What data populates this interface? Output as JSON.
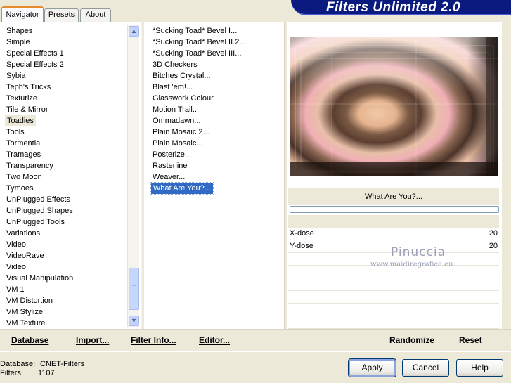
{
  "tabs": [
    {
      "label": "Navigator",
      "active": true
    },
    {
      "label": "Presets",
      "active": false
    },
    {
      "label": "About",
      "active": false
    }
  ],
  "banner_title": "Filters Unlimited 2.0",
  "categories": [
    "Shapes",
    "Simple",
    "Special Effects 1",
    "Special Effects 2",
    "Sybia",
    "Teph's Tricks",
    "Texturize",
    "Tile & Mirror",
    "Toadies",
    "Tools",
    "Tormentia",
    "Tramages",
    "Transparency",
    "Two Moon",
    "Tymoes",
    "UnPlugged Effects",
    "UnPlugged Shapes",
    "UnPlugged Tools",
    "Variations",
    "Video",
    "VideoRave",
    "Video",
    "Visual Manipulation",
    "VM 1",
    "VM Distortion",
    "VM Stylize",
    "VM Texture"
  ],
  "selected_category": "Toadies",
  "filters": [
    "*Sucking Toad*  Bevel I...",
    "*Sucking Toad*  Bevel II.2...",
    "*Sucking Toad*  Bevel III...",
    "3D Checkers",
    "Bitches Crystal...",
    "Blast 'em!...",
    "Glasswork Colour",
    "Motion Trail...",
    "Ommadawn...",
    "Plain Mosaic 2...",
    "Plain Mosaic...",
    "Posterize...",
    "Rasterline",
    "Weaver...",
    "What Are You?..."
  ],
  "selected_filter": "What Are You?...",
  "filter_name_display": "What Are You?...",
  "params": [
    {
      "label": "X-dose",
      "value": "20"
    },
    {
      "label": "Y-dose",
      "value": "20"
    }
  ],
  "watermark": {
    "name": "Pinuccia",
    "url": "www.maidiregrafica.eu"
  },
  "bottom_left_buttons": {
    "database": "Database",
    "import": "Import...",
    "filter_info": "Filter Info...",
    "editor": "Editor..."
  },
  "bottom_right_buttons": {
    "randomize": "Randomize",
    "reset": "Reset"
  },
  "status": {
    "database_label": "Database:",
    "database_value": "ICNET-Filters",
    "filters_label": "Filters:",
    "filters_value": "1107"
  },
  "dialog_buttons": {
    "apply": "Apply",
    "cancel": "Cancel",
    "help": "Help"
  },
  "colors": {
    "selection": "#316ac5",
    "banner": "#0a1a7e",
    "tab_accent": "#e68b2c"
  }
}
